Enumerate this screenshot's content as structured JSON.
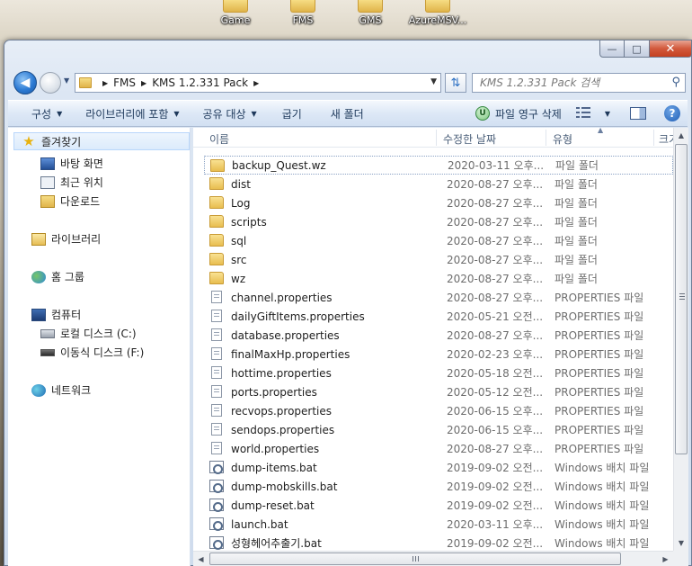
{
  "desktop": {
    "icons": [
      {
        "label": "Game"
      },
      {
        "label": "FMS"
      },
      {
        "label": "GMS"
      },
      {
        "label": "AzureMSV..."
      }
    ]
  },
  "window": {
    "minimize": "—",
    "maximize": "□",
    "close": "✕"
  },
  "address": {
    "crumbs": [
      "FMS",
      "KMS 1.2.331 Pack"
    ],
    "search_placeholder": "KMS 1.2.331 Pack 검색"
  },
  "toolbar": {
    "organize": "구성",
    "include_library": "라이브러리에 포함",
    "share": "공유 대상",
    "burn": "굽기",
    "new_folder": "새 폴더",
    "delete_permanently": "파일 영구 삭제"
  },
  "nav": {
    "favorites": "즐겨찾기",
    "desktop": "바탕 화면",
    "recent": "최근 위치",
    "downloads": "다운로드",
    "libraries": "라이브러리",
    "homegroup": "홈 그룹",
    "computer": "컴퓨터",
    "local_disk": "로컬 디스크 (C:)",
    "removable_disk": "이동식 디스크 (F:)",
    "network": "네트워크"
  },
  "columns": {
    "name": "이름",
    "date": "수정한 날짜",
    "type": "유형",
    "size": "크기"
  },
  "files": [
    {
      "name": "backup_Quest.wz",
      "date": "2020-03-11 오후...",
      "type": "파일 폴더",
      "icon": "folder-icon"
    },
    {
      "name": "dist",
      "date": "2020-08-27 오후...",
      "type": "파일 폴더",
      "icon": "folder-icon"
    },
    {
      "name": "Log",
      "date": "2020-08-27 오후...",
      "type": "파일 폴더",
      "icon": "folder-icon"
    },
    {
      "name": "scripts",
      "date": "2020-08-27 오후...",
      "type": "파일 폴더",
      "icon": "folder-icon"
    },
    {
      "name": "sql",
      "date": "2020-08-27 오후...",
      "type": "파일 폴더",
      "icon": "folder-icon"
    },
    {
      "name": "src",
      "date": "2020-08-27 오후...",
      "type": "파일 폴더",
      "icon": "folder-icon"
    },
    {
      "name": "wz",
      "date": "2020-08-27 오후...",
      "type": "파일 폴더",
      "icon": "folder-icon"
    },
    {
      "name": "channel.properties",
      "date": "2020-08-27 오후...",
      "type": "PROPERTIES 파일",
      "icon": "document-icon"
    },
    {
      "name": "dailyGiftItems.properties",
      "date": "2020-05-21 오전...",
      "type": "PROPERTIES 파일",
      "icon": "document-icon"
    },
    {
      "name": "database.properties",
      "date": "2020-08-27 오후...",
      "type": "PROPERTIES 파일",
      "icon": "document-icon"
    },
    {
      "name": "finalMaxHp.properties",
      "date": "2020-02-23 오후...",
      "type": "PROPERTIES 파일",
      "icon": "document-icon"
    },
    {
      "name": "hottime.properties",
      "date": "2020-05-18 오전...",
      "type": "PROPERTIES 파일",
      "icon": "document-icon"
    },
    {
      "name": "ports.properties",
      "date": "2020-05-12 오전...",
      "type": "PROPERTIES 파일",
      "icon": "document-icon"
    },
    {
      "name": "recvops.properties",
      "date": "2020-06-15 오후...",
      "type": "PROPERTIES 파일",
      "icon": "document-icon"
    },
    {
      "name": "sendops.properties",
      "date": "2020-06-15 오후...",
      "type": "PROPERTIES 파일",
      "icon": "document-icon"
    },
    {
      "name": "world.properties",
      "date": "2020-08-27 오후...",
      "type": "PROPERTIES 파일",
      "icon": "document-icon"
    },
    {
      "name": "dump-items.bat",
      "date": "2019-09-02 오전...",
      "type": "Windows 배치 파일",
      "icon": "batch-file-icon"
    },
    {
      "name": "dump-mobskills.bat",
      "date": "2019-09-02 오전...",
      "type": "Windows 배치 파일",
      "icon": "batch-file-icon"
    },
    {
      "name": "dump-reset.bat",
      "date": "2019-09-02 오전...",
      "type": "Windows 배치 파일",
      "icon": "batch-file-icon"
    },
    {
      "name": "launch.bat",
      "date": "2020-03-11 오후...",
      "type": "Windows 배치 파일",
      "icon": "batch-file-icon"
    },
    {
      "name": "성형헤어추출기.bat",
      "date": "2019-09-02 오전...",
      "type": "Windows 배치 파일",
      "icon": "batch-file-icon"
    }
  ]
}
